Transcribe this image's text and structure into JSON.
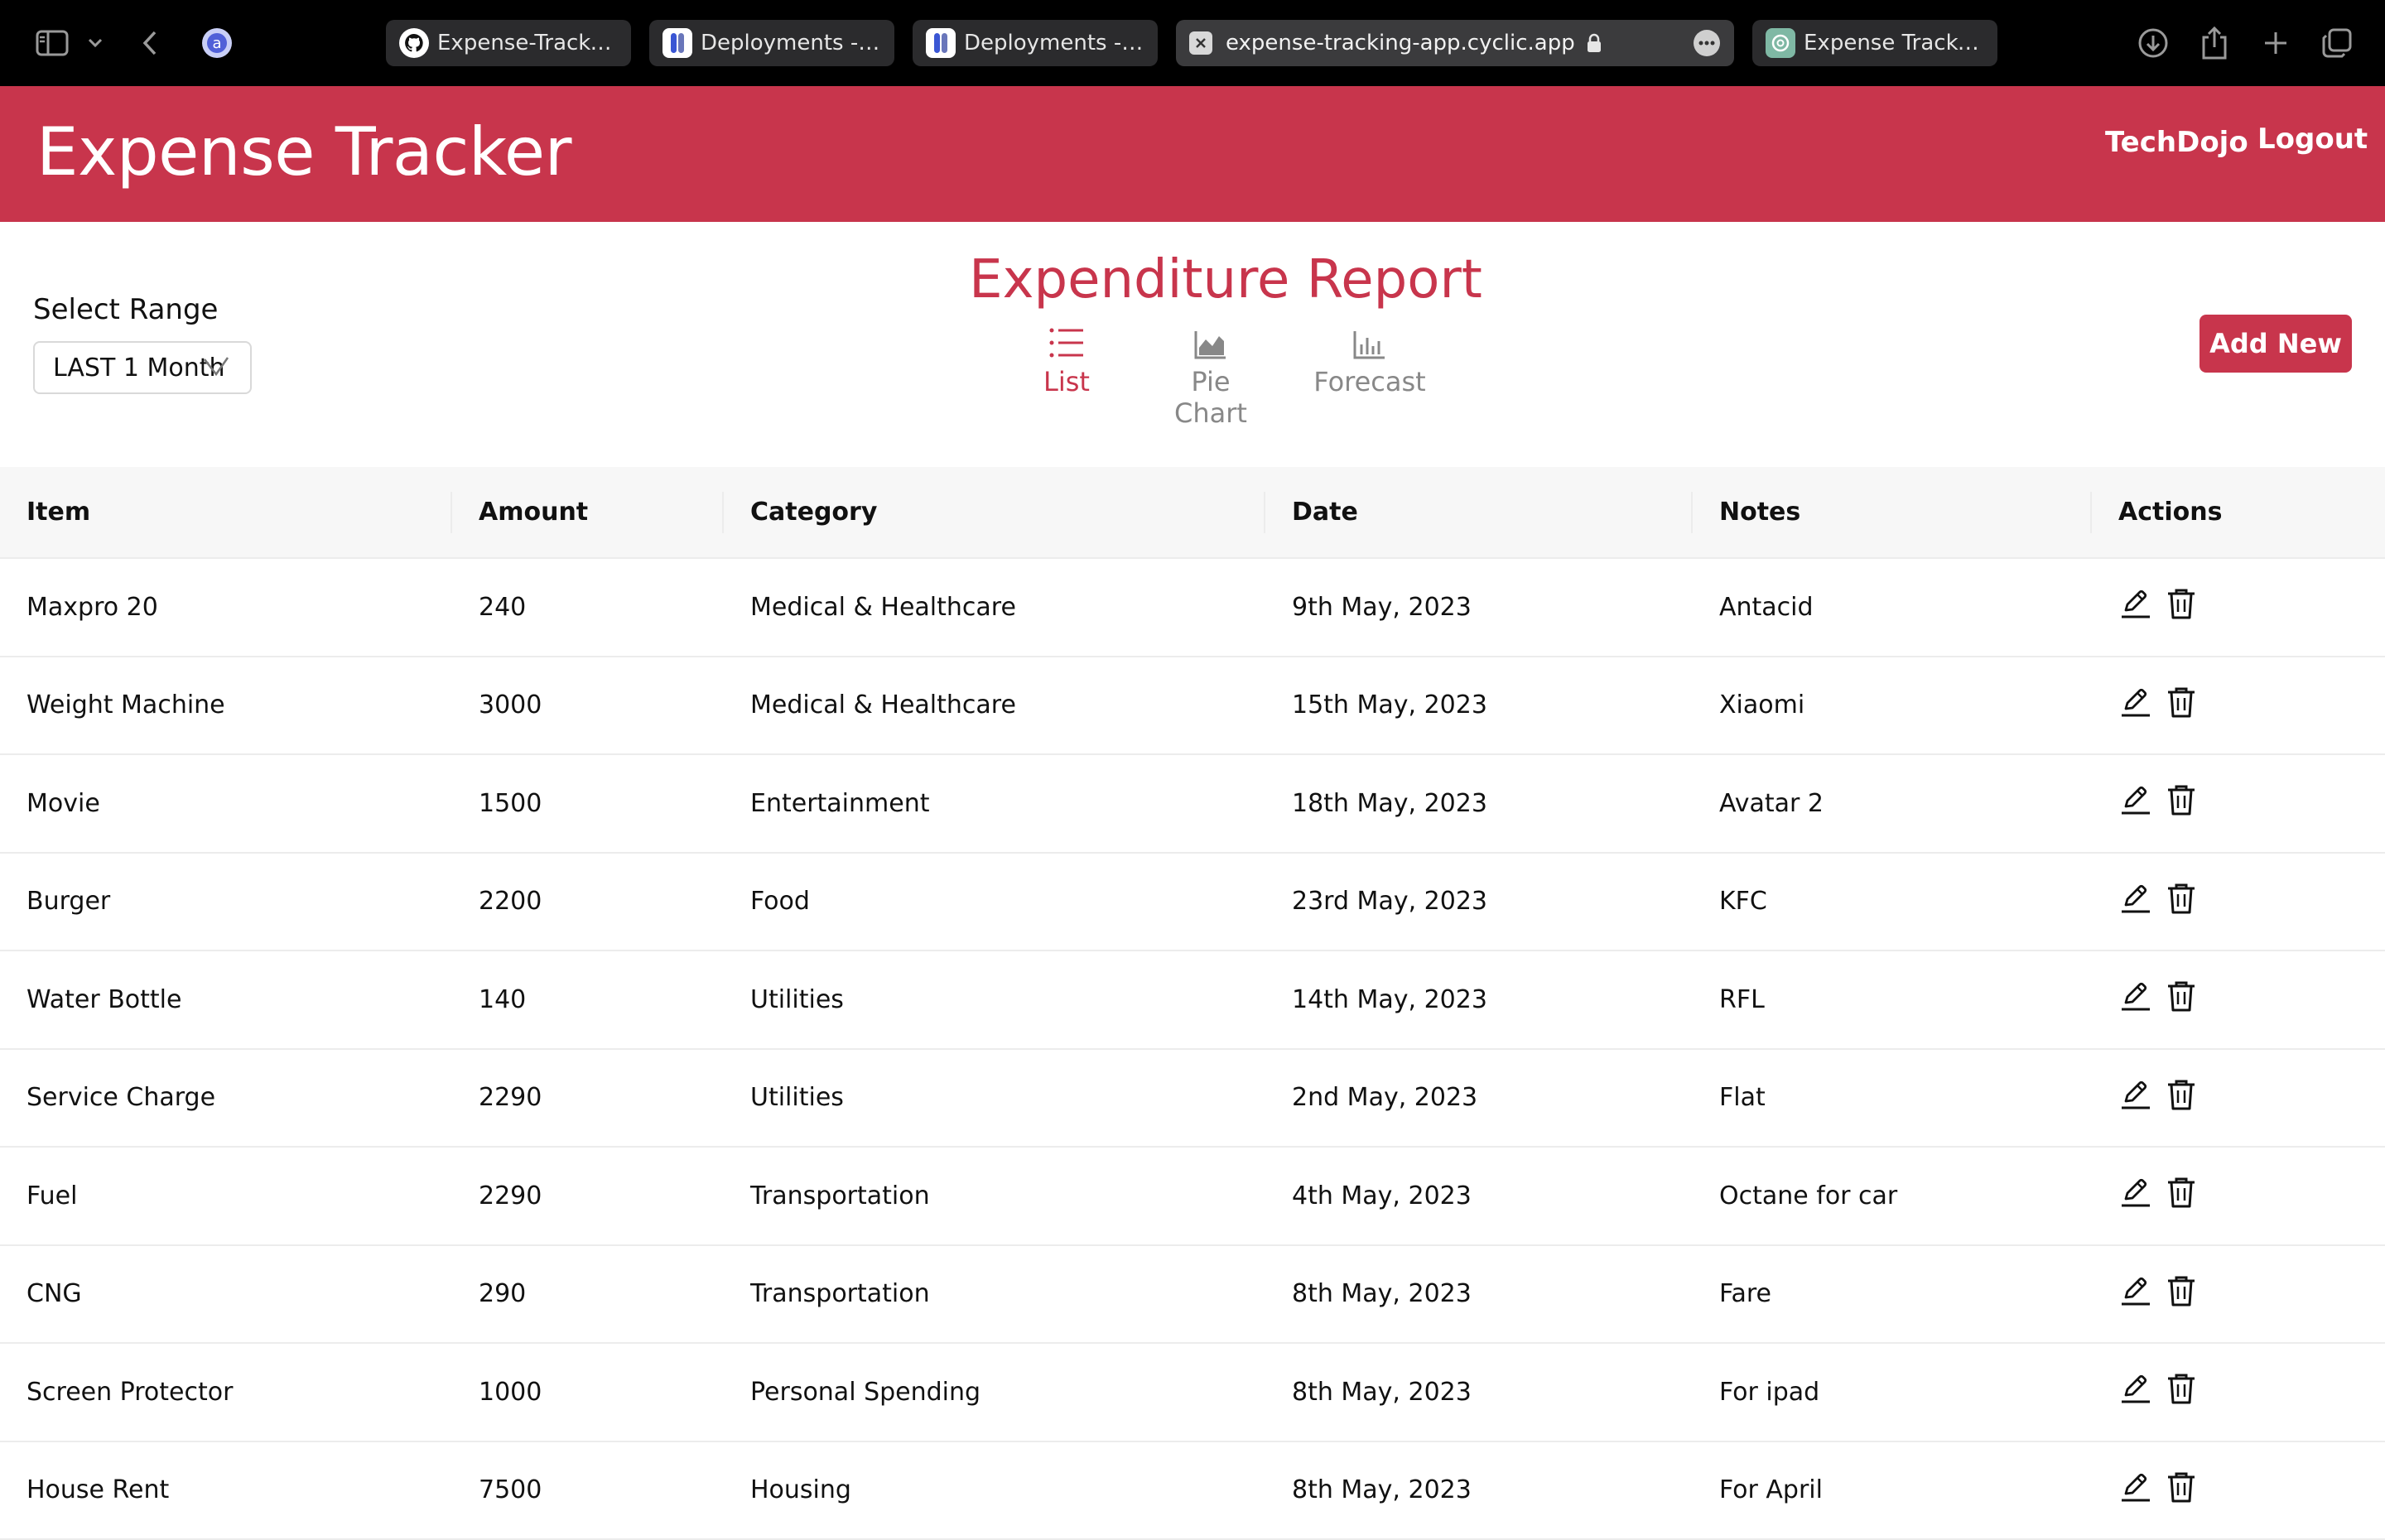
{
  "browser": {
    "tabs": [
      {
        "title": "Expense-Tracker/...",
        "icon": "github-icon"
      },
      {
        "title": "Deployments - d...",
        "icon": "cyclic-icon"
      },
      {
        "title": "Deployments - d...",
        "icon": "cyclic-icon"
      },
      {
        "title": "expense-tracking-app.cyclic.app",
        "icon": "close-tab-icon",
        "active": true
      },
      {
        "title": "Expense Tracker...",
        "icon": "chatgpt-icon"
      }
    ],
    "extension_letter": "a"
  },
  "header": {
    "brand": "Expense Tracker",
    "user": "TechDojo",
    "logout": "Logout",
    "color": "#c8354c"
  },
  "toolbar": {
    "range_label": "Select Range",
    "range_value": "LAST 1 Month",
    "report_title": "Expenditure Report",
    "views": {
      "list": "List",
      "pie": "Pie Chart",
      "forecast": "Forecast"
    },
    "active_view": "List",
    "add_new": "Add New"
  },
  "table": {
    "columns": {
      "item": "Item",
      "amount": "Amount",
      "category": "Category",
      "date": "Date",
      "notes": "Notes",
      "actions": "Actions"
    },
    "rows": [
      {
        "item": "Maxpro 20",
        "amount": "240",
        "category": "Medical & Healthcare",
        "date": "9th May, 2023",
        "notes": "Antacid"
      },
      {
        "item": "Weight Machine",
        "amount": "3000",
        "category": "Medical & Healthcare",
        "date": "15th May, 2023",
        "notes": "Xiaomi"
      },
      {
        "item": "Movie",
        "amount": "1500",
        "category": "Entertainment",
        "date": "18th May, 2023",
        "notes": "Avatar 2"
      },
      {
        "item": "Burger",
        "amount": "2200",
        "category": "Food",
        "date": "23rd May, 2023",
        "notes": "KFC"
      },
      {
        "item": "Water Bottle",
        "amount": "140",
        "category": "Utilities",
        "date": "14th May, 2023",
        "notes": "RFL"
      },
      {
        "item": "Service Charge",
        "amount": "2290",
        "category": "Utilities",
        "date": "2nd May, 2023",
        "notes": "Flat"
      },
      {
        "item": "Fuel",
        "amount": "2290",
        "category": "Transportation",
        "date": "4th May, 2023",
        "notes": "Octane for car"
      },
      {
        "item": "CNG",
        "amount": "290",
        "category": "Transportation",
        "date": "8th May, 2023",
        "notes": "Fare"
      },
      {
        "item": "Screen Protector",
        "amount": "1000",
        "category": "Personal Spending",
        "date": "8th May, 2023",
        "notes": "For ipad"
      },
      {
        "item": "House Rent",
        "amount": "7500",
        "category": "Housing",
        "date": "8th May, 2023",
        "notes": "For April"
      }
    ]
  }
}
